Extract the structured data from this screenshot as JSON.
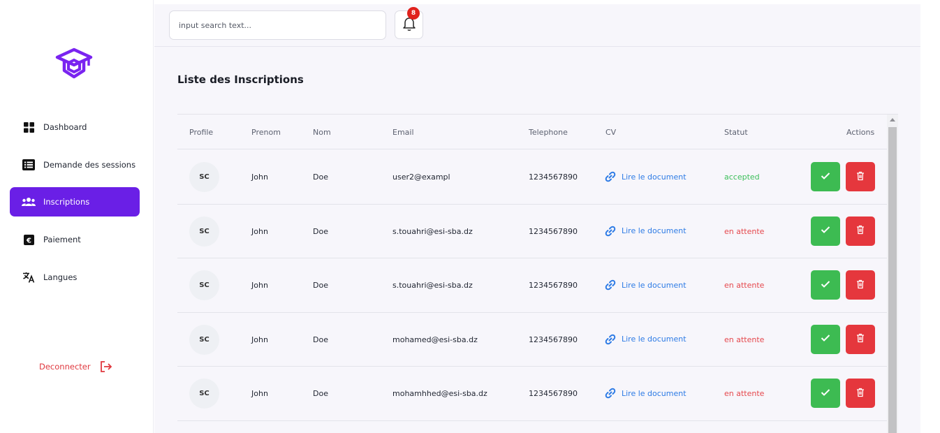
{
  "sidebar": {
    "logo_icon": "graduation-cap-logo",
    "items": [
      {
        "label": "Dashboard",
        "icon": "grid-icon",
        "active": false
      },
      {
        "label": "Demande des sessions",
        "icon": "list-icon",
        "active": false
      },
      {
        "label": "Inscriptions",
        "icon": "users-icon",
        "active": true
      },
      {
        "label": "Paiement",
        "icon": "euro-icon",
        "active": false
      },
      {
        "label": "Langues",
        "icon": "translate-icon",
        "active": false
      }
    ],
    "logout_label": "Deconnecter",
    "accent_color": "#6a1fe6"
  },
  "topbar": {
    "search_placeholder": "input search text...",
    "notifications_count": "8"
  },
  "main": {
    "title": "Liste des Inscriptions",
    "columns": [
      "Profile",
      "Prenom",
      "Nom",
      "Email",
      "Telephone",
      "CV",
      "Statut",
      "Actions"
    ],
    "rows": [
      {
        "initials": "SC",
        "prenom": "John",
        "nom": "Doe",
        "email": "user2@exampl",
        "telephone": "1234567890",
        "cv": "Lire le document",
        "statut": "accepted"
      },
      {
        "initials": "SC",
        "prenom": "John",
        "nom": "Doe",
        "email": "s.touahri@esi-sba.dz",
        "telephone": "1234567890",
        "cv": "Lire le document",
        "statut": "en attente"
      },
      {
        "initials": "SC",
        "prenom": "John",
        "nom": "Doe",
        "email": "s.touahri@esi-sba.dz",
        "telephone": "1234567890",
        "cv": "Lire le document",
        "statut": "en attente"
      },
      {
        "initials": "SC",
        "prenom": "John",
        "nom": "Doe",
        "email": "mohamed@esi-sba.dz",
        "telephone": "1234567890",
        "cv": "Lire le document",
        "statut": "en attente"
      },
      {
        "initials": "SC",
        "prenom": "John",
        "nom": "Doe",
        "email": "mohamhhed@esi-sba.dz",
        "telephone": "1234567890",
        "cv": "Lire le document",
        "statut": "en attente"
      }
    ],
    "colors": {
      "accepted": "#3cbf5a",
      "pending": "#e5484d",
      "accept_button": "#3dbb52",
      "delete_button": "#e5373d",
      "link": "#2d7be5"
    }
  }
}
